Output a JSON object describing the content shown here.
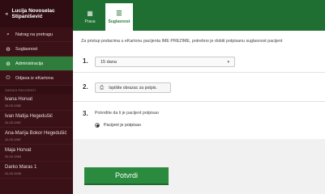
{
  "user": {
    "name_line1": "Lucija Novoselac",
    "name_line2": "Stipanišević"
  },
  "nav": [
    {
      "label": "Natrag na pretragu",
      "icon": "search-icon"
    },
    {
      "label": "Suglasnost",
      "icon": "gear-icon"
    },
    {
      "label": "Administracija",
      "icon": "gear-icon"
    },
    {
      "label": "Odjava iz eKartona",
      "icon": "power-icon"
    }
  ],
  "patients_section_title": "ZADNJI PACIJENTI",
  "patients": [
    {
      "name": "Ivana Horvat",
      "date": "31.03.1982"
    },
    {
      "name": "Ivan Matija Hegedušić",
      "date": "31.03.1967"
    },
    {
      "name": "Ana-Marija Bokor Hegedušić",
      "date": "31.03.1987"
    },
    {
      "name": "Maja Horvat",
      "date": "31.03.1963"
    },
    {
      "name": "Darko Maras 1",
      "date": "31.03.1943"
    }
  ],
  "tabs": [
    {
      "label": "Prava",
      "icon": "grid-icon"
    },
    {
      "label": "Suglasnost",
      "icon": "list-icon"
    }
  ],
  "main": {
    "intro": "Za pristup podacima u eKartonu pacijenta IME PREZIME, potrebno je dobiti potpisanu suglasnost pacijent",
    "step1": {
      "number": "1.",
      "select_value": "15 dana"
    },
    "step2": {
      "number": "2.",
      "print_label": "Ispišite obrazac za potpis."
    },
    "step3": {
      "number": "3.",
      "question": "Potvrdite da li je pacijent potpisao",
      "radio_label": "Pacijent je potpisao"
    },
    "confirm_label": "Potvrdi"
  }
}
